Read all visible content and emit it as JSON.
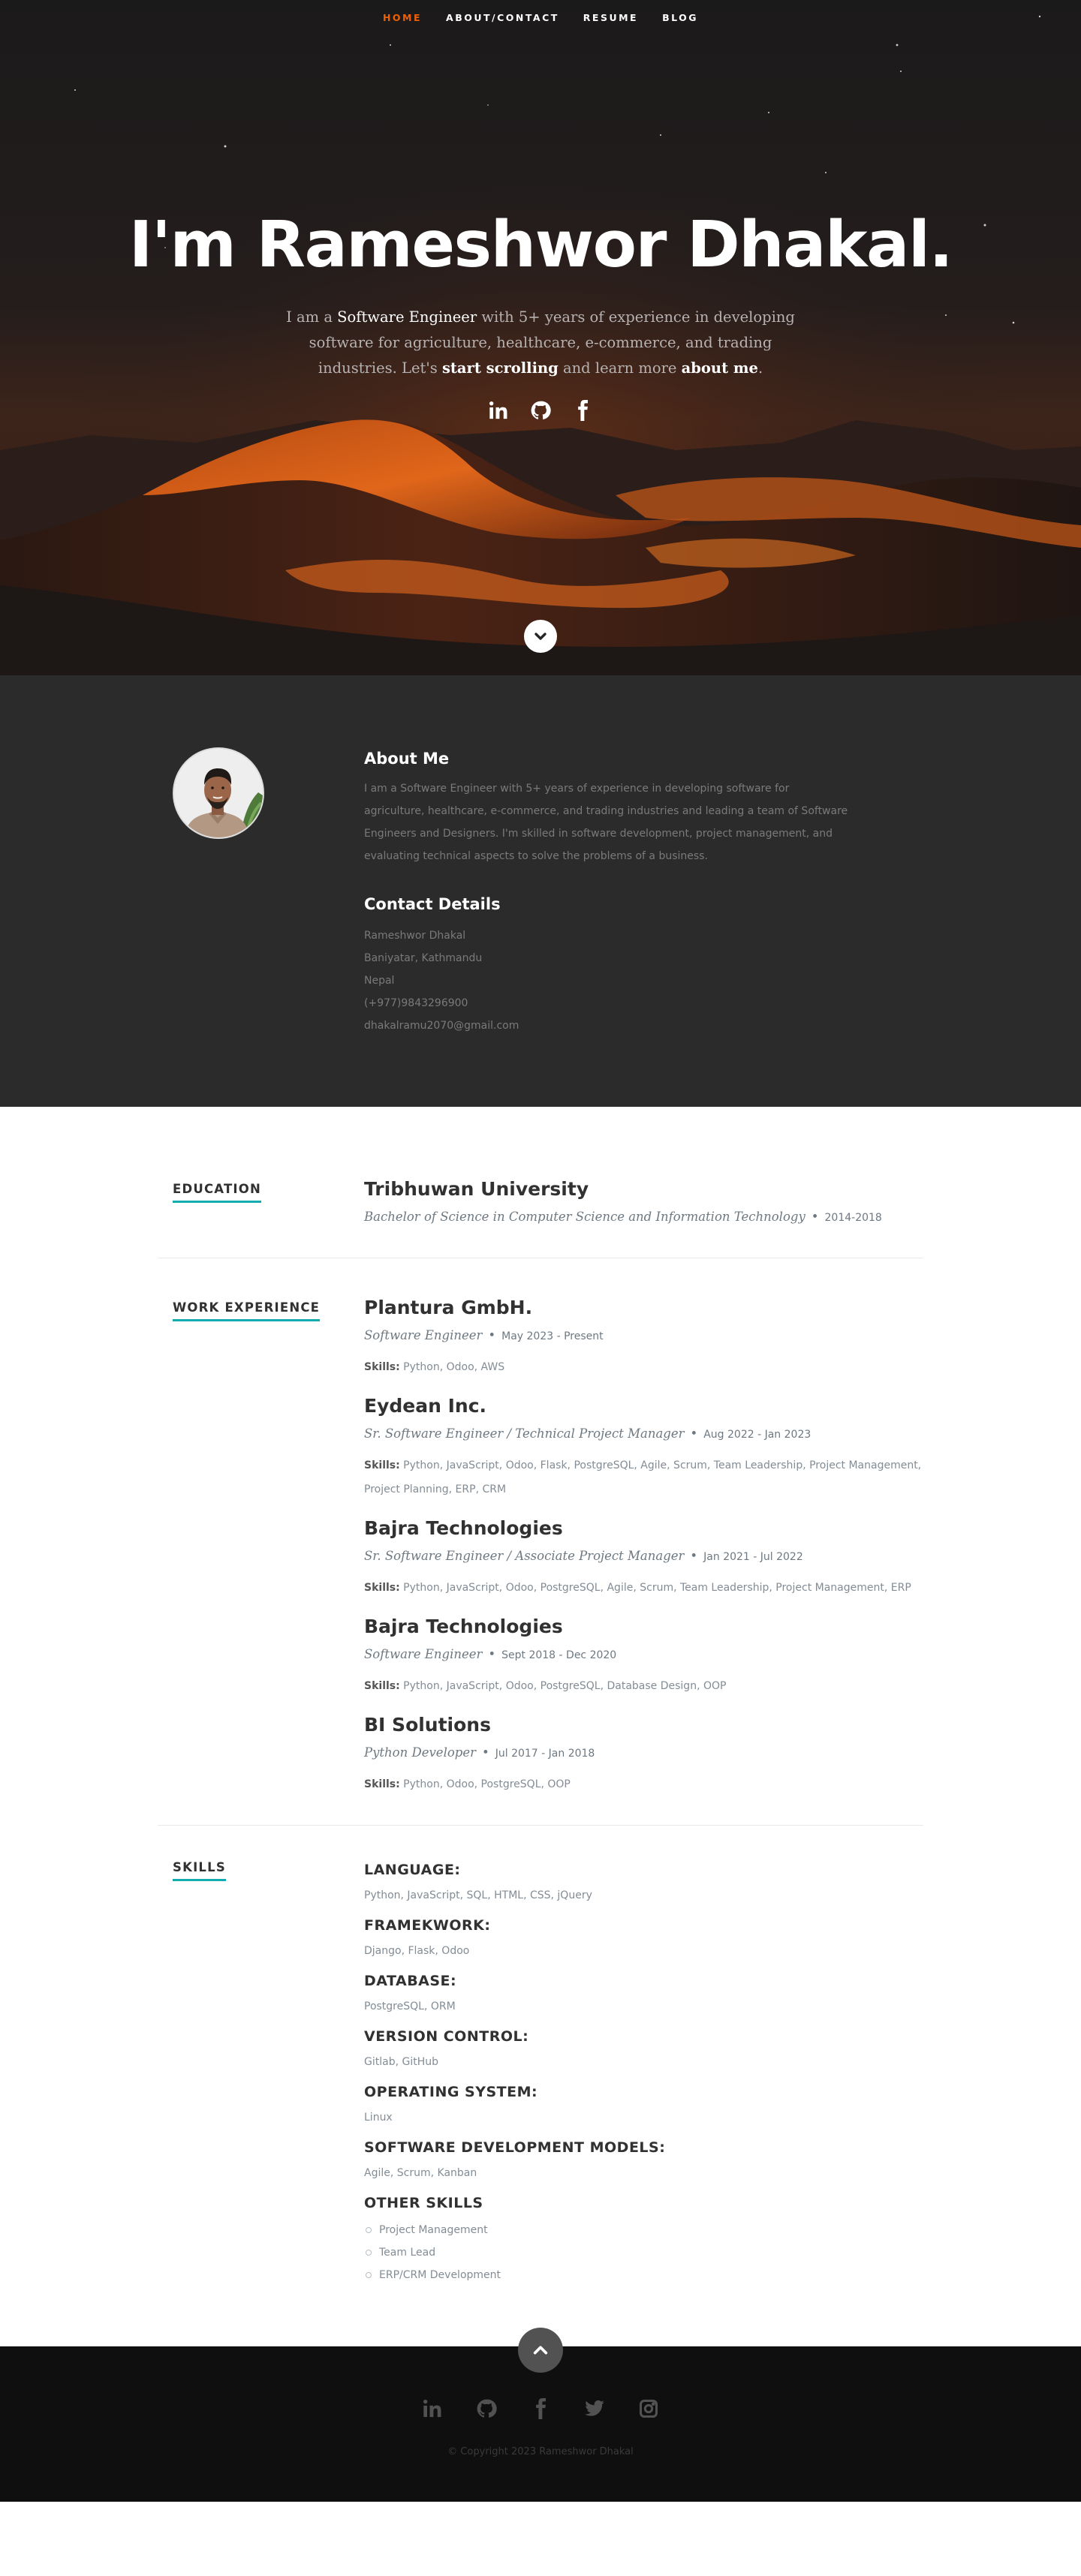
{
  "nav": {
    "items": [
      {
        "label": "HOME",
        "active": true
      },
      {
        "label": "ABOUT/CONTACT",
        "active": false
      },
      {
        "label": "RESUME",
        "active": false
      },
      {
        "label": "BLOG",
        "active": false
      }
    ]
  },
  "hero": {
    "title": "I'm Rameshwor Dhakal.",
    "sub_1": "I am a ",
    "sub_role": "Software Engineer",
    "sub_2": " with 5+ years of experience in developing software for agriculture, healthcare, e-commerce, and trading industries. Let's ",
    "sub_start": "start scrolling",
    "sub_3": " and learn more ",
    "sub_about": "about me",
    "sub_4": ".",
    "social_icons": [
      "linkedin-icon",
      "github-icon",
      "facebook-icon"
    ]
  },
  "about": {
    "title": "About Me",
    "text": "I am a Software Engineer with 5+ years of experience in developing software for agriculture, healthcare, e-commerce, and trading industries and leading a team of Software Engineers and Designers. I'm skilled in software development, project management, and evaluating technical aspects to solve the problems of a business.",
    "contact_title": "Contact Details",
    "contact": {
      "name": "Rameshwor Dhakal",
      "address1": "Baniyatar, Kathmandu",
      "address2": "Nepal",
      "phone": "(+977)9843296900",
      "email": "dhakalramu2070@gmail.com"
    }
  },
  "education": {
    "label": "EDUCATION",
    "school": "Tribhuwan University",
    "degree": "Bachelor of Science in Computer Science and Information Technology",
    "dot": "•",
    "years": "2014-2018"
  },
  "work": {
    "label": "WORK EXPERIENCE",
    "skills_label": "Skills:",
    "jobs": [
      {
        "company": "Plantura GmbH.",
        "title": "Software Engineer",
        "dot": "•",
        "date": "May 2023 - Present",
        "skills": " Python, Odoo, AWS"
      },
      {
        "company": "Eydean Inc.",
        "title": "Sr. Software Engineer / Technical Project Manager",
        "dot": "•",
        "date": "Aug 2022 - Jan 2023",
        "skills": " Python, JavaScript, Odoo, Flask, PostgreSQL, Agile, Scrum, Team Leadership, Project Management, Project Planning, ERP, CRM"
      },
      {
        "company": "Bajra Technologies",
        "title": "Sr. Software Engineer / Associate Project Manager",
        "dot": "•",
        "date": "Jan 2021 - Jul 2022",
        "skills": " Python, JavaScript, Odoo, PostgreSQL, Agile, Scrum, Team Leadership, Project Management, ERP"
      },
      {
        "company": "Bajra Technologies",
        "title": "Software Engineer",
        "dot": "•",
        "date": "Sept 2018 - Dec 2020",
        "skills": " Python, JavaScript, Odoo, PostgreSQL, Database Design, OOP"
      },
      {
        "company": "BI Solutions",
        "title": "Python Developer",
        "dot": "•",
        "date": "Jul 2017 - Jan 2018",
        "skills": " Python, Odoo, PostgreSQL, OOP"
      }
    ]
  },
  "skills": {
    "label": "SKILLS",
    "groups": [
      {
        "title": "LANGUAGE:",
        "value": "Python, JavaScript, SQL, HTML, CSS, jQuery"
      },
      {
        "title": "FRAMEKWORK:",
        "value": "Django, Flask, Odoo"
      },
      {
        "title": "DATABASE:",
        "value": "PostgreSQL, ORM"
      },
      {
        "title": "VERSION CONTROL:",
        "value": "Gitlab, GitHub"
      },
      {
        "title": "OPERATING SYSTEM:",
        "value": "Linux"
      },
      {
        "title": "SOFTWARE DEVELOPMENT MODELS:",
        "value": "Agile, Scrum, Kanban"
      }
    ],
    "other_title": "OTHER SKILLS",
    "other": [
      "Project Management",
      "Team Lead",
      "ERP/CRM Development"
    ]
  },
  "footer": {
    "social_icons": [
      "linkedin-icon",
      "github-icon",
      "facebook-icon",
      "twitter-icon",
      "instagram-icon"
    ],
    "copyright": "© Copyright 2023 Rameshwor Dhakal"
  },
  "colors": {
    "accent": "#F06000",
    "underline": "#11ABB0",
    "about_bg": "#2b2b2b",
    "footer_bg": "#0f0f0f"
  }
}
